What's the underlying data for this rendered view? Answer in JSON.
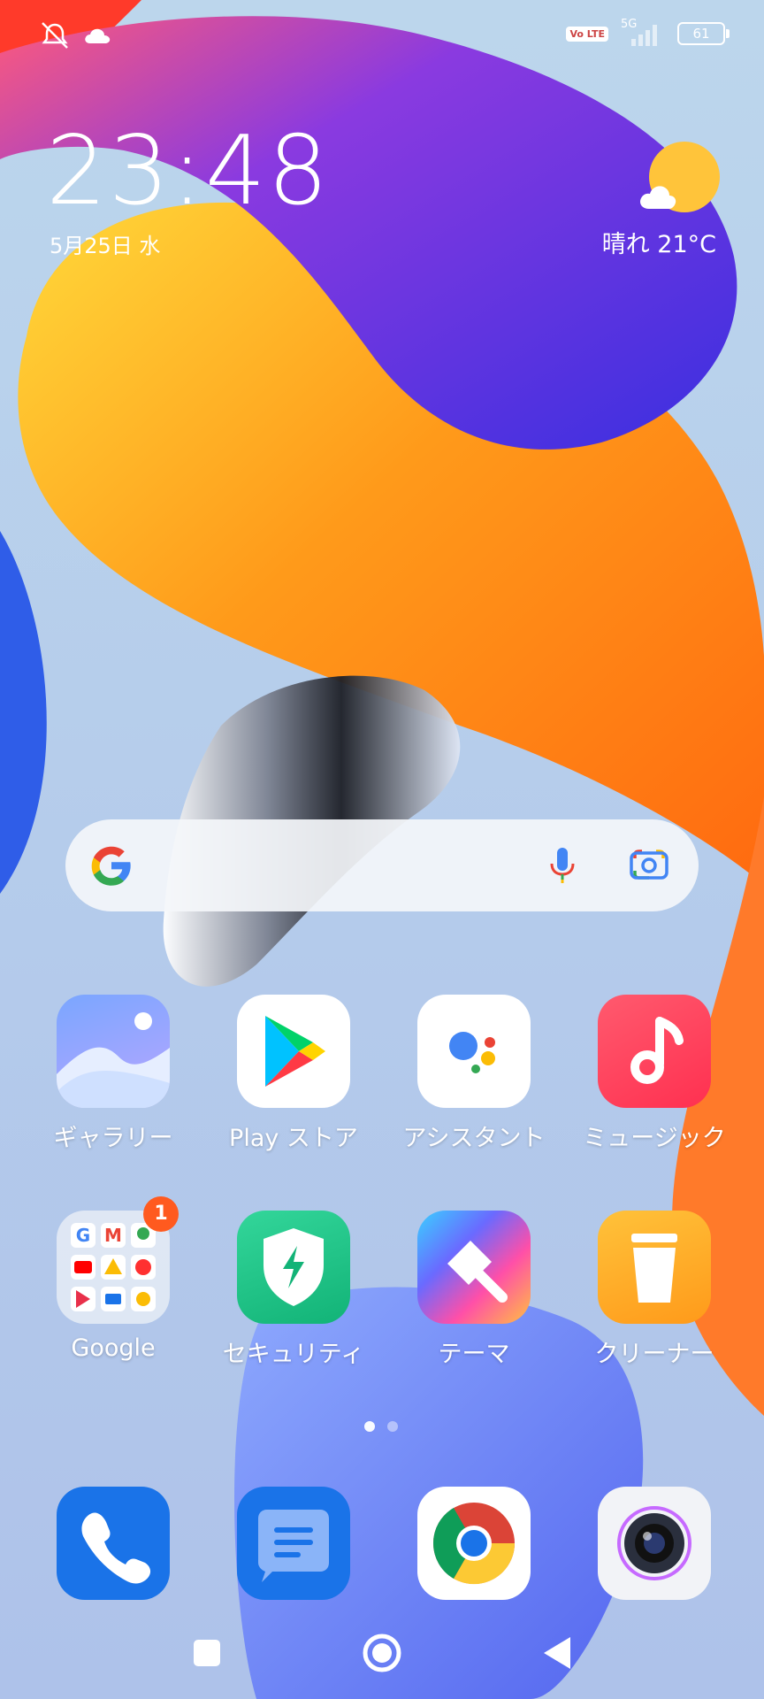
{
  "status_bar": {
    "left_icons": [
      "vibrate-off-icon",
      "cloud-icon"
    ],
    "volte": "Vo LTE",
    "network": "5G",
    "battery": "61"
  },
  "clock": {
    "time": "23:48",
    "date": "5月25日 水"
  },
  "weather": {
    "icon": "partly-sunny-icon",
    "text": "晴れ  21°C"
  },
  "search": {
    "icons": [
      "google-logo-icon",
      "microphone-icon",
      "lens-icon"
    ]
  },
  "apps_row1": [
    {
      "label": "ギャラリー",
      "icon": "gallery-icon"
    },
    {
      "label": "Play ストア",
      "icon": "play-store-icon"
    },
    {
      "label": "アシスタント",
      "icon": "assistant-icon"
    },
    {
      "label": "ミュージック",
      "icon": "music-icon"
    }
  ],
  "apps_row2": [
    {
      "label": "Google",
      "icon": "google-folder-icon",
      "badge": "1"
    },
    {
      "label": "セキュリティ",
      "icon": "security-icon"
    },
    {
      "label": "テーマ",
      "icon": "themes-icon"
    },
    {
      "label": "クリーナー",
      "icon": "cleaner-icon"
    }
  ],
  "dock": [
    {
      "icon": "phone-icon"
    },
    {
      "icon": "messages-icon"
    },
    {
      "icon": "chrome-icon"
    },
    {
      "icon": "camera-icon"
    }
  ],
  "page_indicator": {
    "current": 1,
    "total": 2
  },
  "nav": [
    "recents-button",
    "home-button",
    "back-button"
  ],
  "colors": {
    "badge": "#ff5a1f",
    "accent_blue": "#1a73e8"
  }
}
